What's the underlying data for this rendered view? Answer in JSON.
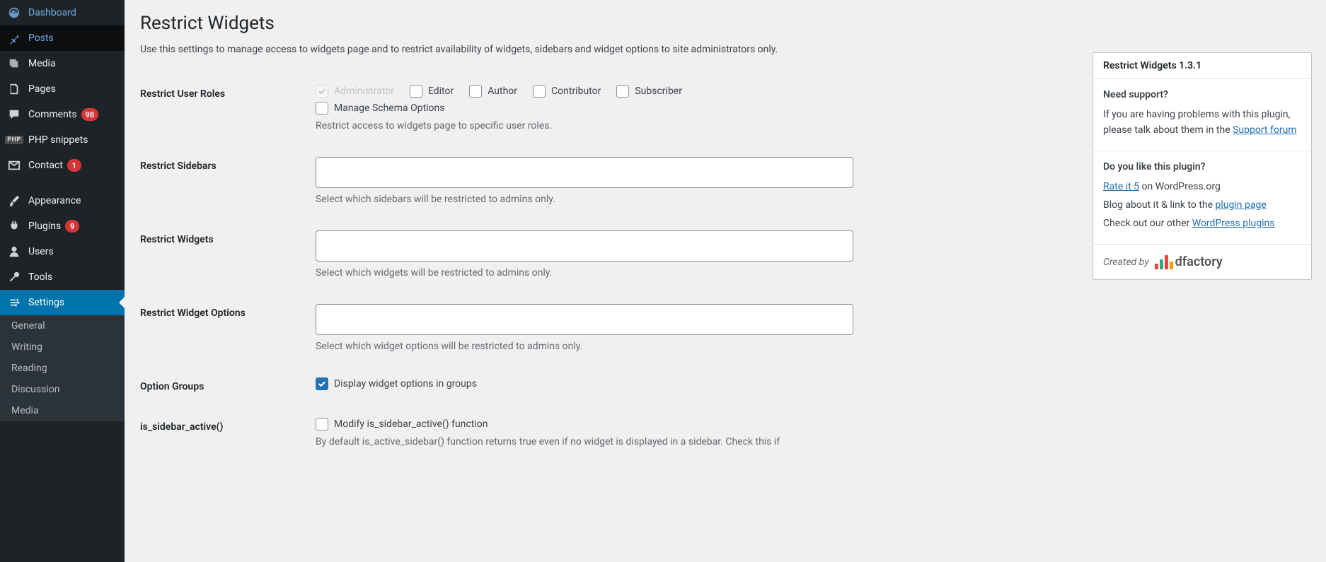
{
  "sidebar": {
    "items": [
      {
        "label": "Dashboard",
        "icon": "dashboard"
      },
      {
        "label": "Posts",
        "icon": "pin",
        "highlight": true
      },
      {
        "label": "Media",
        "icon": "media"
      },
      {
        "label": "Pages",
        "icon": "pages"
      },
      {
        "label": "Comments",
        "icon": "comments",
        "badge": "98"
      },
      {
        "label": "PHP snippets",
        "icon": "php"
      },
      {
        "label": "Contact",
        "icon": "mail",
        "badge": "1"
      },
      {
        "label": "Appearance",
        "icon": "brush"
      },
      {
        "label": "Plugins",
        "icon": "plug",
        "badge": "9"
      },
      {
        "label": "Users",
        "icon": "user"
      },
      {
        "label": "Tools",
        "icon": "wrench"
      },
      {
        "label": "Settings",
        "icon": "settings",
        "current": true
      }
    ],
    "submenu": [
      {
        "label": "General"
      },
      {
        "label": "Writing"
      },
      {
        "label": "Reading"
      },
      {
        "label": "Discussion"
      },
      {
        "label": "Media"
      }
    ]
  },
  "page": {
    "title": "Restrict Widgets",
    "intro": "Use this settings to manage access to widgets page and to restrict availability of widgets, sidebars and widget options to site administrators only."
  },
  "form": {
    "roles": {
      "label": "Restrict User Roles",
      "desc": "Restrict access to widgets page to specific user roles.",
      "options": [
        "Administrator",
        "Editor",
        "Author",
        "Contributor",
        "Subscriber",
        "Manage Schema Options"
      ]
    },
    "sidebars": {
      "label": "Restrict Sidebars",
      "desc": "Select which sidebars will be restricted to admins only."
    },
    "widgets": {
      "label": "Restrict Widgets",
      "desc": "Select which widgets will be restricted to admins only."
    },
    "options": {
      "label": "Restrict Widget Options",
      "desc": "Select which widget options will be restricted to admins only."
    },
    "groups": {
      "label": "Option Groups",
      "checkbox": "Display widget options in groups"
    },
    "sidebar_active": {
      "label": "is_sidebar_active()",
      "checkbox": "Modify is_sidebar_active() function",
      "desc": "By default is_active_sidebar() function returns true even if no widget is displayed in a sidebar. Check this if"
    }
  },
  "side": {
    "box_title": "Restrict Widgets 1.3.1",
    "support": {
      "heading": "Need support?",
      "text_a": "If you are having problems with this plugin, please talk about them in the ",
      "link": "Support forum"
    },
    "like": {
      "heading": "Do you like this plugin?",
      "rate_link": "Rate it 5",
      "rate_suffix": " on WordPress.org",
      "blog_text": "Blog about it & link to the ",
      "blog_link": "plugin page",
      "check_text": "Check out our other ",
      "check_link": "WordPress plugins"
    },
    "created": {
      "prefix": "Created by",
      "brand": "dfactory"
    }
  }
}
